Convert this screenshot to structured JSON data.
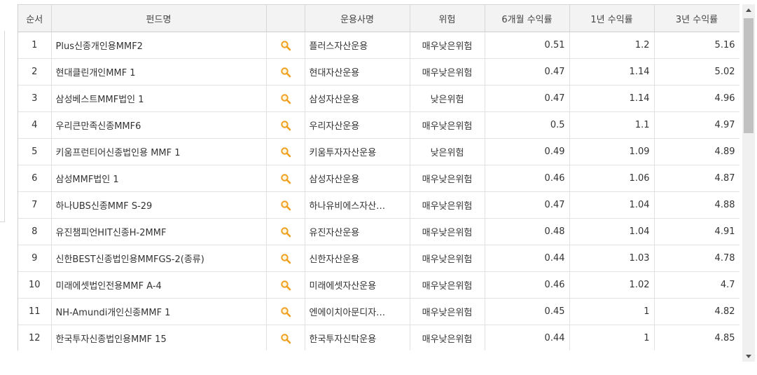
{
  "table": {
    "headers": [
      "순서",
      "펀드명",
      "",
      "운용사명",
      "위험",
      "6개월 수익률",
      "1년 수익률",
      "3년 수익률"
    ],
    "rows": [
      {
        "no": "1",
        "name": "Plus신종개인용MMF2",
        "company": "플러스자산운용",
        "risk": "매우낮은위험",
        "r6m": "0.51",
        "r1y": "1.2",
        "r3y": "5.16"
      },
      {
        "no": "2",
        "name": "현대클린개인MMF 1",
        "company": "현대자산운용",
        "risk": "매우낮은위험",
        "r6m": "0.47",
        "r1y": "1.14",
        "r3y": "5.02"
      },
      {
        "no": "3",
        "name": "삼성베스트MMF법인 1",
        "company": "삼성자산운용",
        "risk": "낮은위험",
        "r6m": "0.47",
        "r1y": "1.14",
        "r3y": "4.96"
      },
      {
        "no": "4",
        "name": "우리큰만족신종MMF6",
        "company": "우리자산운용",
        "risk": "매우낮은위험",
        "r6m": "0.5",
        "r1y": "1.1",
        "r3y": "4.97"
      },
      {
        "no": "5",
        "name": "키움프런티어신종법인용 MMF 1",
        "company": "키움투자자산운용",
        "risk": "낮은위험",
        "r6m": "0.49",
        "r1y": "1.09",
        "r3y": "4.89"
      },
      {
        "no": "6",
        "name": "삼성MMF법인 1",
        "company": "삼성자산운용",
        "risk": "매우낮은위험",
        "r6m": "0.46",
        "r1y": "1.06",
        "r3y": "4.87"
      },
      {
        "no": "7",
        "name": "하나UBS신종MMF S-29",
        "company": "하나유비에스자산…",
        "risk": "매우낮은위험",
        "r6m": "0.47",
        "r1y": "1.04",
        "r3y": "4.88"
      },
      {
        "no": "8",
        "name": "유진챔피언HIT신종H-2MMF",
        "company": "유진자산운용",
        "risk": "매우낮은위험",
        "r6m": "0.48",
        "r1y": "1.04",
        "r3y": "4.91"
      },
      {
        "no": "9",
        "name": "신한BEST신종법인용MMFGS-2(종류)",
        "company": "신한자산운용",
        "risk": "매우낮은위험",
        "r6m": "0.44",
        "r1y": "1.03",
        "r3y": "4.78"
      },
      {
        "no": "10",
        "name": "미래에셋법인전용MMF A-4",
        "company": "미래에셋자산운용",
        "risk": "매우낮은위험",
        "r6m": "0.46",
        "r1y": "1.02",
        "r3y": "4.7"
      },
      {
        "no": "11",
        "name": "NH-Amundi개인신종MMF 1",
        "company": "엔에이치아문디자…",
        "risk": "매우낮은위험",
        "r6m": "0.45",
        "r1y": "1",
        "r3y": "4.82"
      },
      {
        "no": "12",
        "name": "한국투자신종법인용MMF 15",
        "company": "한국투자신탁운용",
        "risk": "매우낮은위험",
        "r6m": "0.44",
        "r1y": "1",
        "r3y": "4.85"
      }
    ]
  },
  "colors": {
    "magnifier": "#f0a020",
    "header_bg": "#f3f3f3",
    "scroll_thumb": "#c1c1c1"
  },
  "icons": {
    "detail": "magnifier-icon"
  }
}
